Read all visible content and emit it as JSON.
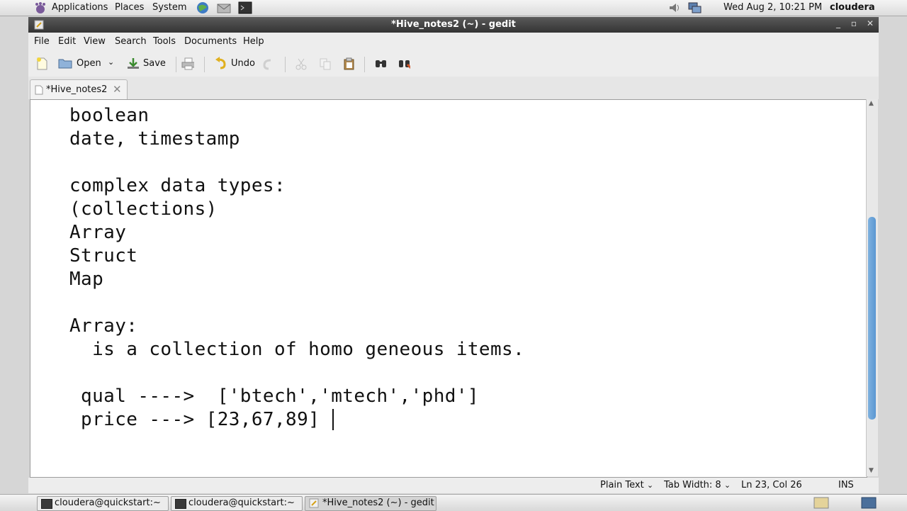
{
  "top_panel": {
    "menus": [
      "Applications",
      "Places",
      "System"
    ],
    "clock": "Wed Aug  2, 10:21 PM",
    "user": "cloudera"
  },
  "window": {
    "title": "*Hive_notes2 (~) - gedit"
  },
  "menubar": [
    "File",
    "Edit",
    "View",
    "Search",
    "Tools",
    "Documents",
    "Help"
  ],
  "toolbar": {
    "open_label": "Open",
    "save_label": "Save",
    "undo_label": "Undo"
  },
  "tab": {
    "label": "*Hive_notes2"
  },
  "editor": {
    "lines": [
      "boolean",
      "date, timestamp",
      "",
      "complex data types:",
      "(collections)",
      "Array",
      "Struct",
      "Map",
      "",
      "Array:",
      "  is a collection of homo geneous items.",
      "",
      " qual ---->  ['btech','mtech','phd']",
      " price ---> [23,67,89]"
    ]
  },
  "statusbar": {
    "language": "Plain Text",
    "tab_width": "Tab Width: 8",
    "position": "Ln 23, Col 26",
    "mode": "INS"
  },
  "taskbar": {
    "items": [
      "cloudera@quickstart:~",
      "cloudera@quickstart:~",
      "*Hive_notes2 (~) - gedit"
    ]
  }
}
